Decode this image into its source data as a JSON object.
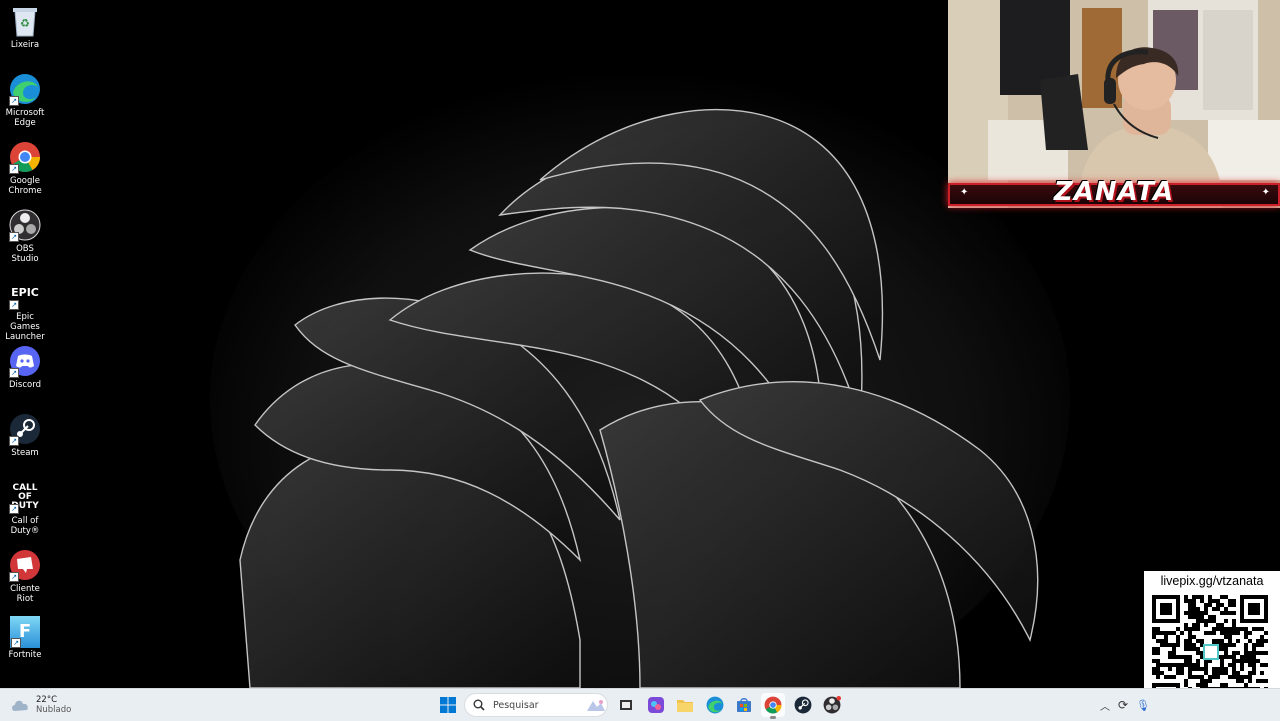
{
  "desktop_icons": [
    {
      "label": "Lixeira",
      "icon": "recycle-bin-icon"
    },
    {
      "label": "Microsoft Edge",
      "icon": "edge-icon"
    },
    {
      "label": "Google Chrome",
      "icon": "chrome-icon"
    },
    {
      "label": "OBS Studio",
      "icon": "obs-icon"
    },
    {
      "label": "Epic Games Launcher",
      "icon": "epic-games-icon",
      "logo_text": "EPIC"
    },
    {
      "label": "Discord",
      "icon": "discord-icon"
    },
    {
      "label": "Steam",
      "icon": "steam-icon"
    },
    {
      "label": "Call of Duty®",
      "icon": "call-of-duty-icon",
      "logo_text": "CALL OF DUTY"
    },
    {
      "label": "Cliente Riot",
      "icon": "riot-icon"
    },
    {
      "label": "Fortnite",
      "icon": "fortnite-icon",
      "logo_text": "F"
    }
  ],
  "webcam": {
    "name": "ZANATA"
  },
  "qr": {
    "label": "livepix.gg/vtzanata"
  },
  "taskbar": {
    "weather": {
      "temp": "22°C",
      "condition": "Nublado"
    },
    "search_placeholder": "Pesquisar",
    "pinned": [
      "start-icon",
      "task-view-icon",
      "copilot-icon",
      "file-explorer-icon",
      "edge-icon",
      "store-icon",
      "chrome-icon",
      "steam-icon",
      "obs-icon"
    ],
    "active_app": "chrome-icon"
  },
  "colors": {
    "taskbar_bg": "#e9eef3",
    "webcam_accent": "#c9202a",
    "windows_blue": "#0078d4"
  }
}
